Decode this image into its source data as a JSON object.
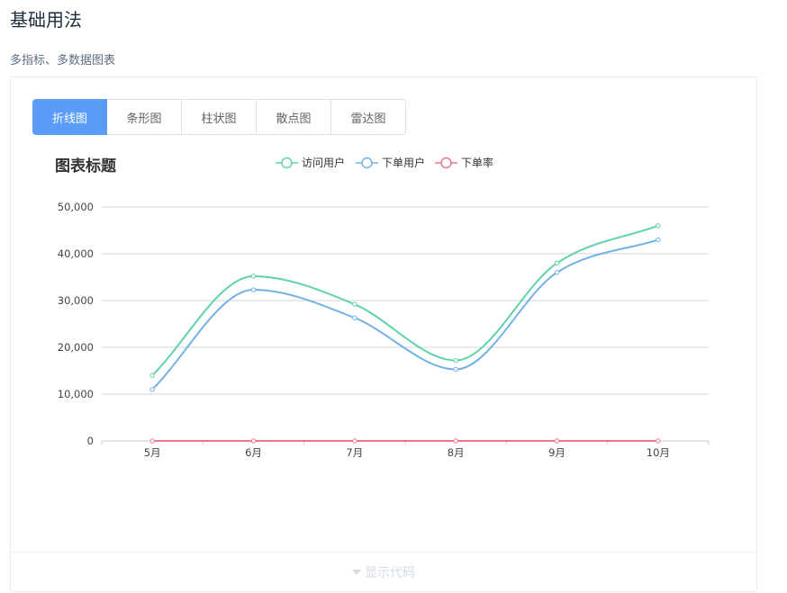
{
  "page": {
    "title": "基础用法",
    "description": "多指标、多数据图表"
  },
  "tabs": [
    {
      "label": "折线图",
      "active": true
    },
    {
      "label": "条形图",
      "active": false
    },
    {
      "label": "柱状图",
      "active": false
    },
    {
      "label": "散点图",
      "active": false
    },
    {
      "label": "雷达图",
      "active": false
    }
  ],
  "footer": {
    "label": "显示代码"
  },
  "chart_data": {
    "type": "line",
    "title": "图表标题",
    "categories": [
      "5月",
      "6月",
      "7月",
      "8月",
      "9月",
      "10月"
    ],
    "series": [
      {
        "name": "访问用户",
        "color": "#5fd3a8",
        "values": [
          14000,
          35200,
          29200,
          17200,
          38000,
          46000
        ]
      },
      {
        "name": "下单用户",
        "color": "#72b0e6",
        "values": [
          11000,
          32300,
          26300,
          15300,
          36000,
          43000
        ]
      },
      {
        "name": "下单率",
        "color": "#e8798a",
        "values": [
          0,
          0,
          0,
          0,
          0,
          0
        ]
      }
    ],
    "yticks": [
      "0",
      "10,000",
      "20,000",
      "30,000",
      "40,000",
      "50,000"
    ],
    "ylim": [
      0,
      50000
    ],
    "grid": true,
    "legend": "top-center",
    "smooth": true
  }
}
